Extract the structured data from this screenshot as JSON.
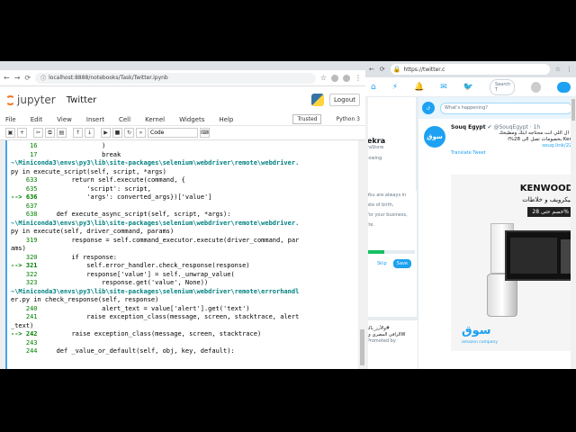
{
  "left_browser": {
    "url": "localhost:8888/notebooks/Task/Twitter.ipynb",
    "jupyter": {
      "logo_text": "jupyter",
      "notebook_title": "Twitter",
      "logout_label": "Logout",
      "menu": [
        "File",
        "Edit",
        "View",
        "Insert",
        "Cell",
        "Kernel",
        "Widgets",
        "Help"
      ],
      "trusted_label": "Trusted",
      "kernel_label": "Python 3",
      "cell_type": "Code"
    },
    "code_lines": [
      {
        "ln": "     16",
        "text": "                )"
      },
      {
        "ln": "     17",
        "text": "                break"
      },
      {
        "ln": "",
        "text": ""
      },
      {
        "ln": "",
        "text": "~\\Miniconda3\\envs\\py3\\lib\\site-packages\\selenium\\webdriver\\remote\\webdriver."
      },
      {
        "ln": "",
        "text": "py in execute_script(self, script, *args)"
      },
      {
        "ln": "    633",
        "text": "        return self.execute(command, {"
      },
      {
        "ln": "    635",
        "text": "            'script': script,"
      },
      {
        "ln": "--> 636",
        "text": "            'args': converted_args})['value']"
      },
      {
        "ln": "    637",
        "text": ""
      },
      {
        "ln": "    638",
        "text": "    def execute_async_script(self, script, *args):"
      },
      {
        "ln": "",
        "text": ""
      },
      {
        "ln": "",
        "text": "~\\Miniconda3\\envs\\py3\\lib\\site-packages\\selenium\\webdriver\\remote\\webdriver."
      },
      {
        "ln": "",
        "text": "py in execute(self, driver_command, params)"
      },
      {
        "ln": "    319",
        "text": "        response = self.command_executor.execute(driver_command, par"
      },
      {
        "ln": "",
        "text": "ams)"
      },
      {
        "ln": "    320",
        "text": "        if response:"
      },
      {
        "ln": "--> 321",
        "text": "            self.error_handler.check_response(response)"
      },
      {
        "ln": "    322",
        "text": "            response['value'] = self._unwrap_value("
      },
      {
        "ln": "    323",
        "text": "                response.get('value', None))"
      },
      {
        "ln": "",
        "text": ""
      },
      {
        "ln": "",
        "text": "~\\Miniconda3\\envs\\py3\\lib\\site-packages\\selenium\\webdriver\\remote\\errorhandl"
      },
      {
        "ln": "",
        "text": "er.py in check_response(self, response)"
      },
      {
        "ln": "    240",
        "text": "                alert_text = value['alert'].get('text')"
      },
      {
        "ln": "    241",
        "text": "            raise exception_class(message, screen, stacktrace, alert"
      },
      {
        "ln": "",
        "text": "_text)"
      },
      {
        "ln": "--> 242",
        "text": "        raise exception_class(message, screen, stacktrace)"
      },
      {
        "ln": "    243",
        "text": ""
      },
      {
        "ln": "    244",
        "text": "    def _value_or_default(self, obj, key, default):"
      }
    ]
  },
  "right_browser": {
    "url": "https://twitter.c",
    "search_placeholder": "Search T",
    "profile": {
      "name": "ekra",
      "sub": "raStore",
      "following": "lowing"
    },
    "modal": {
      "text1": "You are always in",
      "text2": "ate of birth,",
      "text3": "for your business,",
      "text4": "ite.",
      "progress": 0.35,
      "skip_label": "Skip",
      "save_label": "Save"
    },
    "trend": {
      "line1": "والأرز_ياكـ#",
      "line2": "الزاقي المصري يW",
      "line3": "Promoted by"
    },
    "compose_placeholder": "What's happening?",
    "compose_avatar_text": "ق",
    "tweet": {
      "avatar_text": "سوق",
      "name": "Souq Egypt",
      "handle": "@SouqEgypt · 1h",
      "text1": "ال اللي انت محتاجه ابتك ومطبخك !",
      "text2": "بخصومات تصل الى 28%ا Ken",
      "link": "souq.link/2Z",
      "translate": "Translate Tweet"
    },
    "ad": {
      "brand": "KENWOOD",
      "arabic_line": "ميكرويف و خلاطات",
      "discount": "خصم حتى 28%",
      "souq_logo": "سوق",
      "souq_sub": "amazon company"
    }
  }
}
